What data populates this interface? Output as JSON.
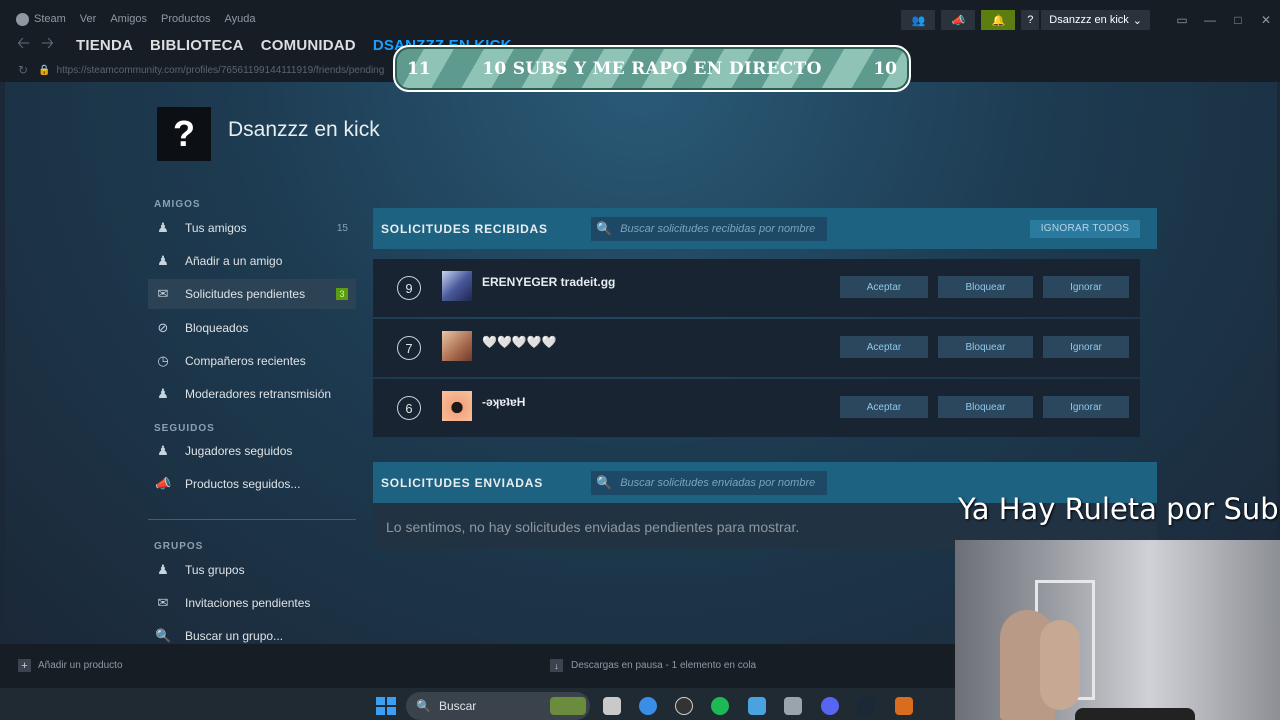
{
  "titlebar": {
    "app_name": "Steam",
    "menu": [
      "Ver",
      "Amigos",
      "Productos",
      "Ayuda"
    ],
    "account": "Dsanzzz en kick",
    "help": "?"
  },
  "nav": {
    "links": [
      "TIENDA",
      "BIBLIOTECA",
      "COMUNIDAD",
      "DSANZZZ EN KICK"
    ],
    "url": "https://steamcommunity.com/profiles/76561199144111919/friends/pending"
  },
  "banner": {
    "left_num": "11",
    "text": "10 SUBS Y ME RAPO EN DIRECTO",
    "right_num": "10"
  },
  "profile": {
    "avatar_glyph": "?",
    "name": "Dsanzzz en kick"
  },
  "sidebar": {
    "sections": {
      "amigos": "AMIGOS",
      "seguidos": "SEGUIDOS",
      "grupos": "GRUPOS"
    },
    "items": [
      {
        "label": "Tus amigos",
        "icon": "person-icon",
        "count": "15"
      },
      {
        "label": "Añadir a un amigo",
        "icon": "add-person-icon"
      },
      {
        "label": "Solicitudes pendientes",
        "icon": "mail-icon",
        "badge": "3"
      },
      {
        "label": "Bloqueados",
        "icon": "blocked-icon"
      },
      {
        "label": "Compañeros recientes",
        "icon": "clock-icon"
      },
      {
        "label": "Moderadores retransmisión",
        "icon": "person-icon"
      },
      {
        "label": "Jugadores seguidos",
        "icon": "followed-person-icon"
      },
      {
        "label": "Productos seguidos...",
        "icon": "megaphone-icon"
      },
      {
        "label": "Tus grupos",
        "icon": "group-icon"
      },
      {
        "label": "Invitaciones pendientes",
        "icon": "mail-icon"
      },
      {
        "label": "Buscar un grupo...",
        "icon": "search-icon"
      }
    ]
  },
  "received": {
    "title": "SOLICITUDES RECIBIDAS",
    "search_placeholder": "Buscar solicitudes recibidas por nombre",
    "ignore_all": "IGNORAR TODOS",
    "accept": "Aceptar",
    "block": "Bloquear",
    "ignore": "Ignorar",
    "requests": [
      {
        "level": "9",
        "name": "ERENYEGER tradeit.gg"
      },
      {
        "level": "7",
        "name": "🤍🤍🤍🤍🤍"
      },
      {
        "level": "6",
        "name": "-ǝʞɐʇɐH"
      }
    ]
  },
  "sent": {
    "title": "SOLICITUDES ENVIADAS",
    "search_placeholder": "Buscar solicitudes enviadas por nombre",
    "empty_message": "Lo sentimos, no hay solicitudes enviadas pendientes para mostrar."
  },
  "overlay": {
    "text": "Ya Hay Ruleta por Sub"
  },
  "statusbar": {
    "add_product": "Añadir un producto",
    "downloads": "Descargas en pausa - 1 elemento en cola"
  },
  "taskbar": {
    "search": "Buscar"
  },
  "colors": {
    "accent": "#1a9fff",
    "panel_header": "#1e6282",
    "notification": "#5c7e10"
  }
}
